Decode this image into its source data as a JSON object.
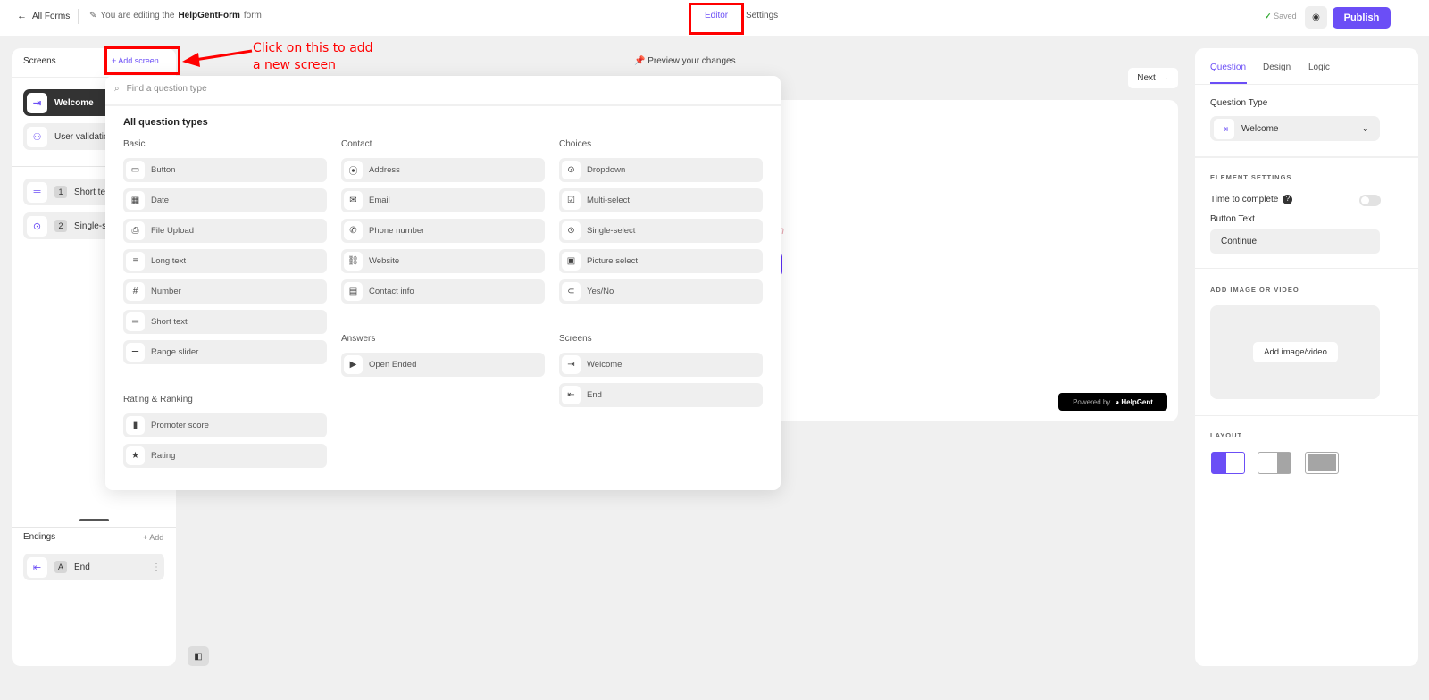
{
  "topbar": {
    "back_label": "All Forms",
    "editing_prefix": "You are editing the",
    "form_name": "HelpGentForm",
    "editing_suffix": "form",
    "tabs": [
      "Editor",
      "Settings"
    ],
    "saved_label": "Saved",
    "publish_label": "Publish"
  },
  "left": {
    "screens_title": "Screens",
    "add_screen_label": "+ Add screen",
    "screens": [
      {
        "label": "Welcome"
      },
      {
        "label": "User validation"
      }
    ],
    "questions": [
      {
        "num": "1",
        "label": "Short text"
      },
      {
        "num": "2",
        "label": "Single-select"
      }
    ],
    "endings_title": "Endings",
    "add_label": "+ Add",
    "endings": [
      {
        "num": "A",
        "label": "End"
      }
    ]
  },
  "preview": {
    "label": "Preview your changes",
    "next_label": "Next",
    "description_placeholder": "ption",
    "powered_by": "Powered by",
    "brand": "HelpGent"
  },
  "popup": {
    "search_placeholder": "Find a question type",
    "title": "All question types",
    "groups": {
      "basic": {
        "title": "Basic",
        "items": [
          "Button",
          "Date",
          "File Upload",
          "Long text",
          "Number",
          "Short text",
          "Range slider"
        ]
      },
      "rating": {
        "title": "Rating & Ranking",
        "items": [
          "Promoter score",
          "Rating"
        ]
      },
      "contact": {
        "title": "Contact",
        "items": [
          "Address",
          "Email",
          "Phone number",
          "Website",
          "Contact info"
        ]
      },
      "answers": {
        "title": "Answers",
        "items": [
          "Open Ended"
        ]
      },
      "choices": {
        "title": "Choices",
        "items": [
          "Dropdown",
          "Multi-select",
          "Single-select",
          "Picture select",
          "Yes/No"
        ]
      },
      "screens": {
        "title": "Screens",
        "items": [
          "Welcome",
          "End"
        ]
      }
    }
  },
  "right": {
    "tabs": [
      "Question",
      "Design",
      "Logic"
    ],
    "question_type_label": "Question Type",
    "question_type_value": "Welcome",
    "element_settings": "ELEMENT SETTINGS",
    "time_to_complete": "Time to complete",
    "time_to_complete_on": false,
    "button_text_label": "Button Text",
    "button_text_value": "Continue",
    "add_media_title": "ADD IMAGE OR VIDEO",
    "add_media_button": "Add image/video",
    "layout_title": "LAYOUT"
  },
  "annotation": {
    "line1": "Click on this to add",
    "line2": "a new screen"
  },
  "colors": {
    "accent": "#6b4ef6",
    "annotation": "#ff0000"
  }
}
